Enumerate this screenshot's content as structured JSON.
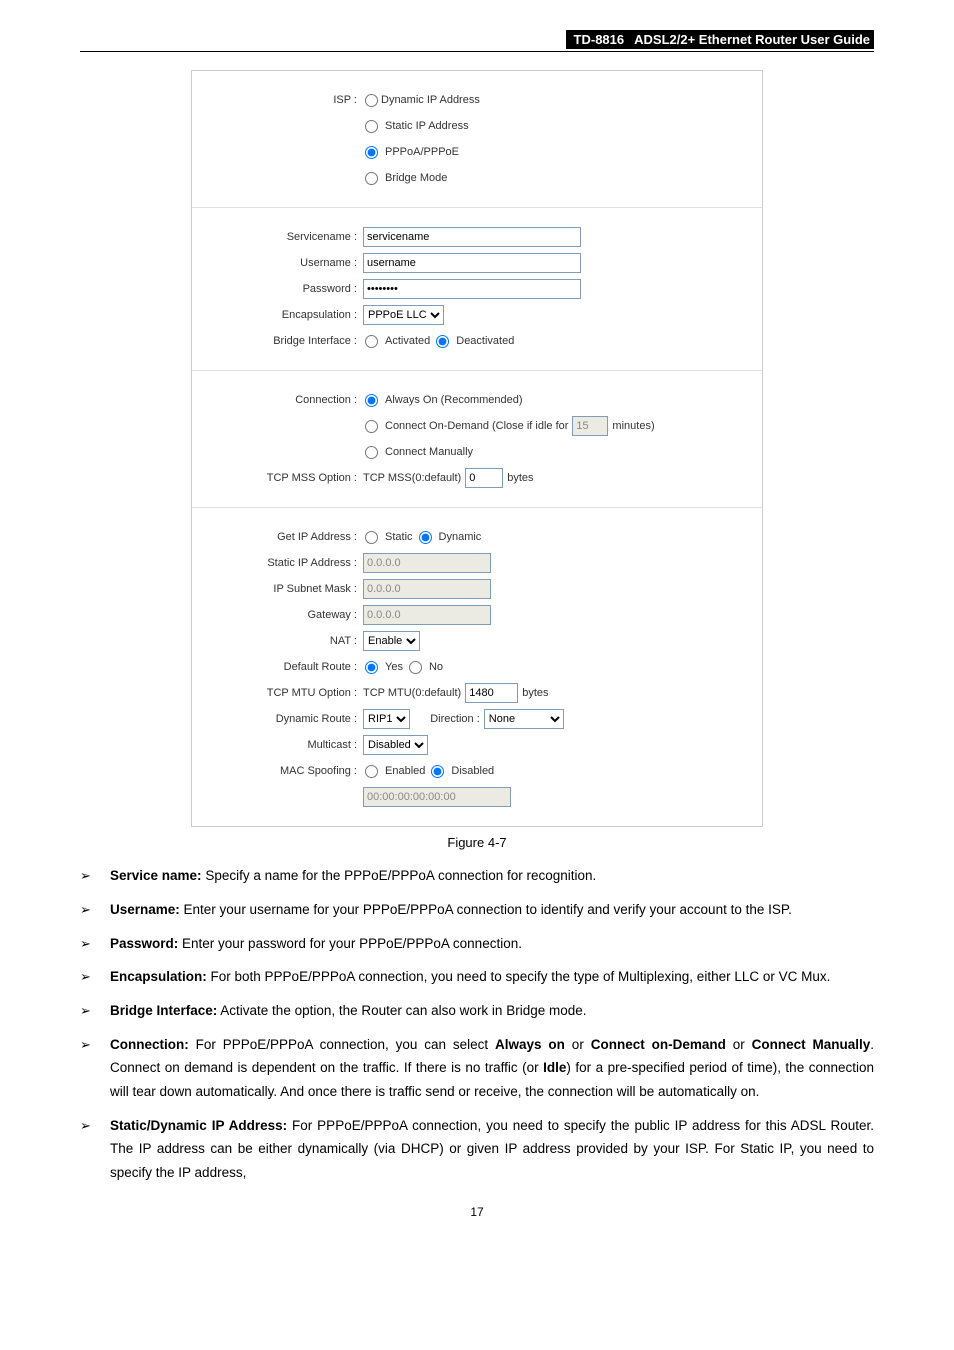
{
  "header": {
    "model": "TD-8816",
    "title": "ADSL2/2+  Ethernet  Router  User  Guide"
  },
  "isp": {
    "label": "ISP :",
    "options": {
      "dynamic": "Dynamic IP Address",
      "static": "Static IP Address",
      "pppoa": "PPPoA/PPPoE",
      "bridge": "Bridge Mode"
    }
  },
  "service": {
    "servicename_label": "Servicename :",
    "servicename_value": "servicename",
    "username_label": "Username :",
    "username_value": "username",
    "password_label": "Password :",
    "password_value": "••••••••",
    "encapsulation_label": "Encapsulation :",
    "encapsulation_value": "PPPoE LLC",
    "bridge_interface_label": "Bridge Interface :",
    "activated": "Activated",
    "deactivated": "Deactivated"
  },
  "connection": {
    "label": "Connection :",
    "always_on": "Always On (Recommended)",
    "on_demand_pre": "Connect On-Demand (Close if idle for",
    "on_demand_value": "15",
    "on_demand_post": "minutes)",
    "manually": "Connect Manually",
    "tcp_mss_label": "TCP MSS Option :",
    "tcp_mss_text": "TCP MSS(0:default)",
    "tcp_mss_value": "0",
    "bytes": "bytes"
  },
  "ip": {
    "get_ip_label": "Get IP Address :",
    "static": "Static",
    "dynamic": "Dynamic",
    "static_ip_label": "Static IP Address :",
    "static_ip_value": "0.0.0.0",
    "subnet_label": "IP Subnet Mask :",
    "subnet_value": "0.0.0.0",
    "gateway_label": "Gateway :",
    "gateway_value": "0.0.0.0",
    "nat_label": "NAT :",
    "nat_value": "Enable",
    "default_route_label": "Default Route :",
    "yes": "Yes",
    "no": "No",
    "tcp_mtu_label": "TCP MTU Option :",
    "tcp_mtu_text": "TCP MTU(0:default)",
    "tcp_mtu_value": "1480",
    "dynamic_route_label": "Dynamic Route :",
    "rip_value": "RIP1",
    "direction_label": "Direction :",
    "direction_value": "None",
    "multicast_label": "Multicast :",
    "multicast_value": "Disabled",
    "mac_spoof_label": "MAC Spoofing :",
    "enabled": "Enabled",
    "disabled": "Disabled",
    "mac_value": "00:00:00:00:00:00"
  },
  "figure_caption": "Figure 4-7",
  "bullets": {
    "b1_strong": "Service name:",
    "b1_text": " Specify a name for the PPPoE/PPPoA connection for recognition.",
    "b2_strong": "Username:",
    "b2_text": " Enter your username for your PPPoE/PPPoA connection to identify and verify your account to the ISP.",
    "b3_strong": "Password:",
    "b3_text": " Enter your password for your PPPoE/PPPoA connection.",
    "b4_strong": "Encapsulation:",
    "b4_text": " For both PPPoE/PPPoA connection, you need to specify the type of Multiplexing, either LLC or VC Mux.",
    "b5_strong": "Bridge Interface:",
    "b5_text": " Activate the option, the Router can also work in Bridge mode.",
    "b6_strong": "Connection:",
    "b6_part1": " For PPPoE/PPPoA connection, you can select ",
    "b6_s1": "Always on",
    "b6_or": " or ",
    "b6_s2": "Connect on-Demand",
    "b6_or2": " or ",
    "b6_s3": "Connect Manually",
    "b6_part2": ". Connect on demand is dependent on the traffic. If there is no traffic (or ",
    "b6_idle": "Idle",
    "b6_part3": ") for a pre-specified period of time), the connection will tear down automatically. And once there is traffic send or receive, the connection will be automatically on.",
    "b7_strong": "Static/Dynamic IP Address:",
    "b7_text": " For PPPoE/PPPoA connection, you need to specify the public IP address for this ADSL Router. The IP address can be either dynamically (via DHCP) or given IP address provided by your ISP. For Static IP, you need to specify the IP address,"
  },
  "page_number": "17"
}
